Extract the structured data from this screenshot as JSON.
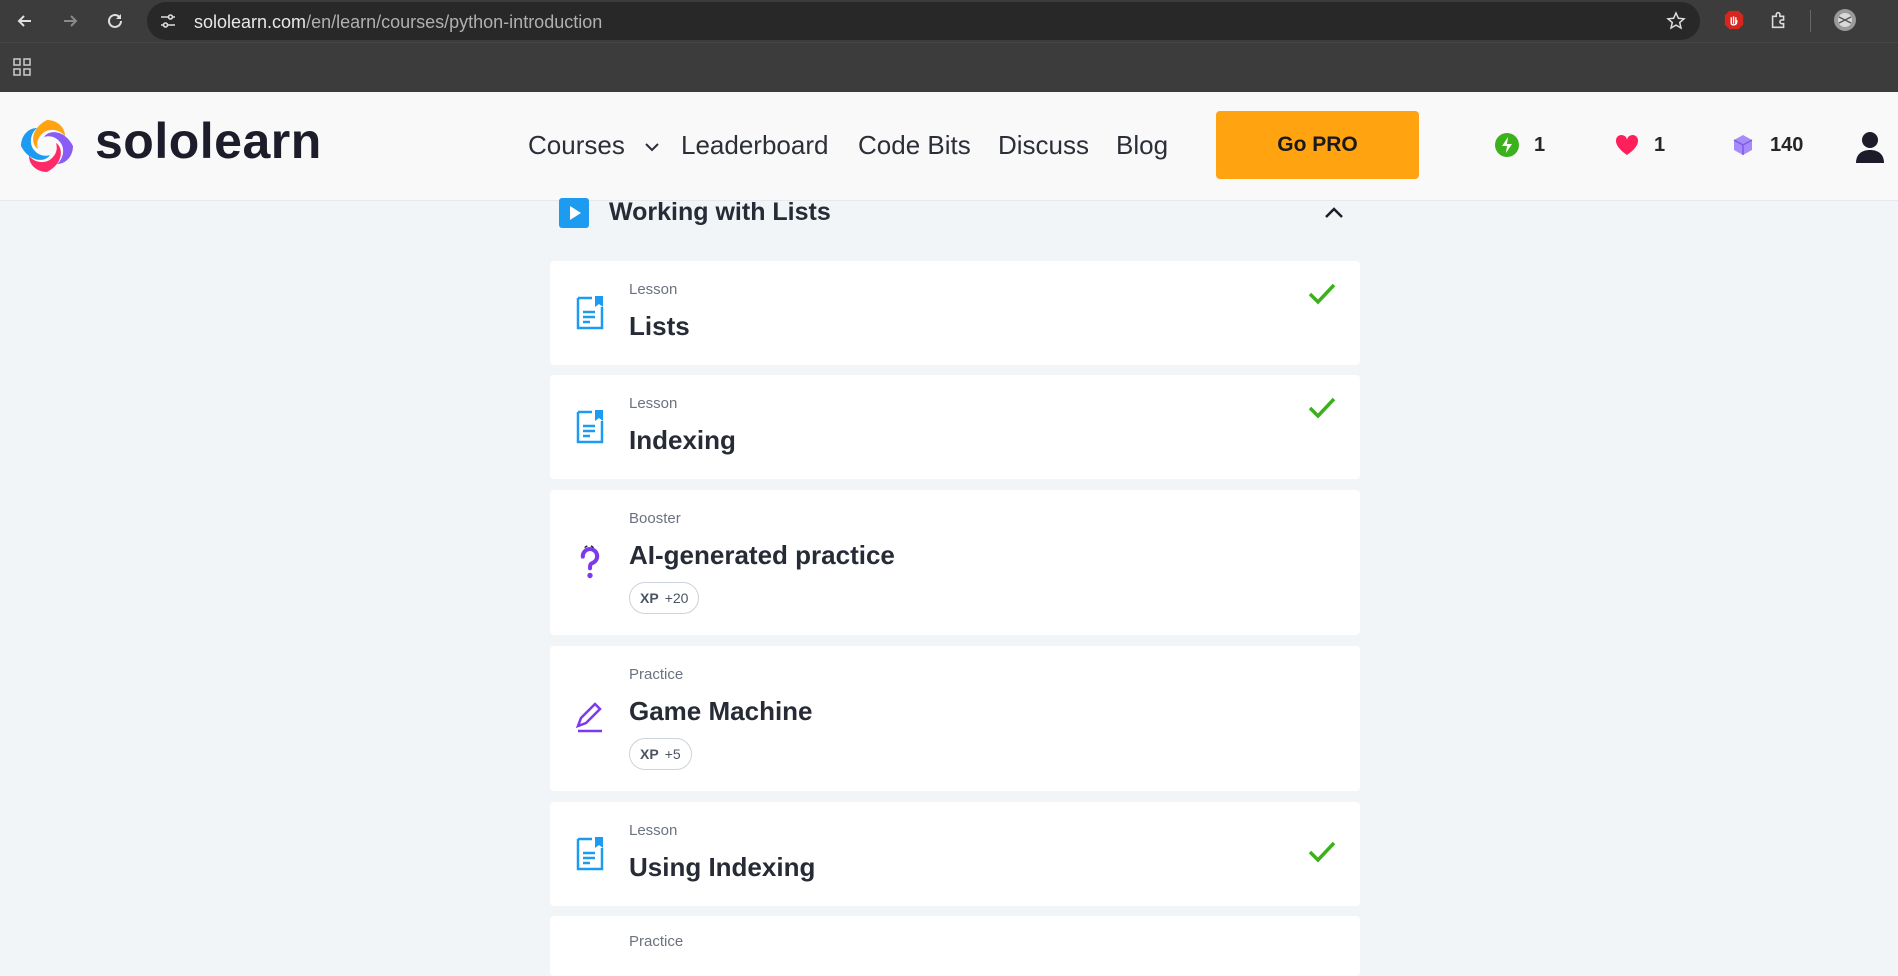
{
  "browser": {
    "url_host": "sololearn.com",
    "url_path": "/en/learn/courses/python-introduction"
  },
  "header": {
    "brand": "sololearn",
    "nav": {
      "courses": "Courses",
      "leaderboard": "Leaderboard",
      "code_bits": "Code Bits",
      "discuss": "Discuss",
      "blog": "Blog"
    },
    "go_pro": "Go PRO",
    "stats": {
      "streak": "1",
      "hearts": "1",
      "bits": "140"
    }
  },
  "section": {
    "title": "Working with Lists"
  },
  "items": [
    {
      "kind": "Lesson",
      "title": "Lists",
      "completed": true,
      "icon": "lesson-icon"
    },
    {
      "kind": "Lesson",
      "title": "Indexing",
      "completed": true,
      "icon": "lesson-icon"
    },
    {
      "kind": "Booster",
      "title": "AI-generated practice",
      "xp_label": "XP",
      "xp_value": "+20",
      "icon": "question-icon"
    },
    {
      "kind": "Practice",
      "title": "Game Machine",
      "xp_label": "XP",
      "xp_value": "+5",
      "icon": "pencil-icon"
    },
    {
      "kind": "Lesson",
      "title": "Using Indexing",
      "completed": true,
      "icon": "lesson-icon"
    },
    {
      "kind": "Practice",
      "title": "",
      "icon": "pencil-icon"
    }
  ],
  "colors": {
    "accent_blue": "#1d9bf0",
    "pro_orange": "#ffa310",
    "check_green": "#3cb01d",
    "purple": "#7c3aed"
  }
}
